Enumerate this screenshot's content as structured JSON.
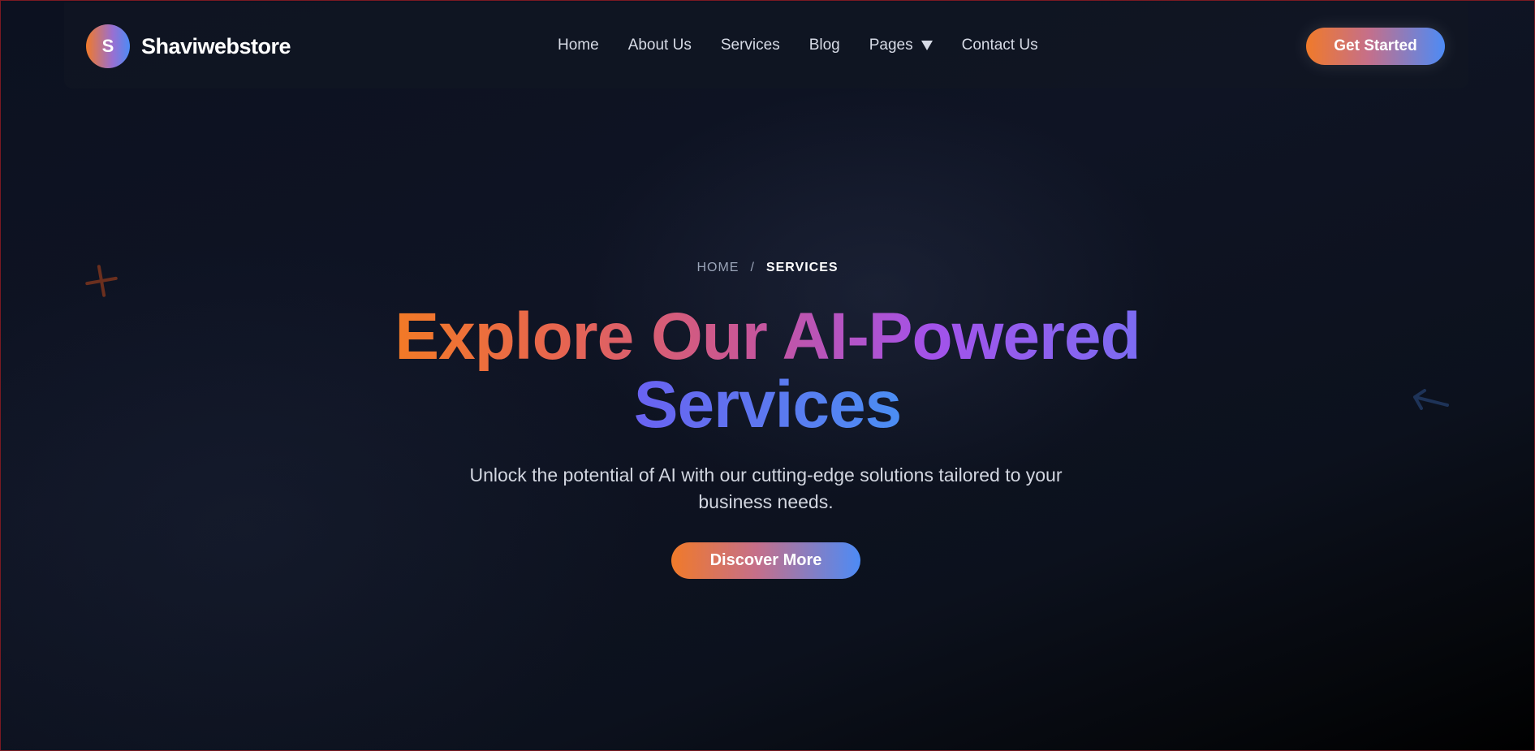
{
  "brand": {
    "logo_letter": "S",
    "name": "Shaviwebstore"
  },
  "nav": {
    "items": [
      {
        "label": "Home"
      },
      {
        "label": "About Us"
      },
      {
        "label": "Services"
      },
      {
        "label": "Blog"
      },
      {
        "label": "Pages",
        "has_dropdown": true
      },
      {
        "label": "Contact Us"
      }
    ],
    "cta_label": "Get Started"
  },
  "breadcrumb": {
    "home": "HOME",
    "separator": "/",
    "current": "SERVICES"
  },
  "hero": {
    "title_line_1": "Explore Our AI-Powered",
    "title_line_2": "Services",
    "subtitle": "Unlock the potential of AI with our cutting-edge solutions tailored to your business needs.",
    "cta_label": "Discover More"
  },
  "icons": {
    "dropdown": "caret-down-icon",
    "deco_plus": "plus-icon",
    "deco_arrow": "arrow-left-icon"
  },
  "colors": {
    "accent_orange": "#f07a2a",
    "accent_purple": "#a352ea",
    "accent_blue": "#4d8bf5",
    "background": "#0f1424"
  }
}
